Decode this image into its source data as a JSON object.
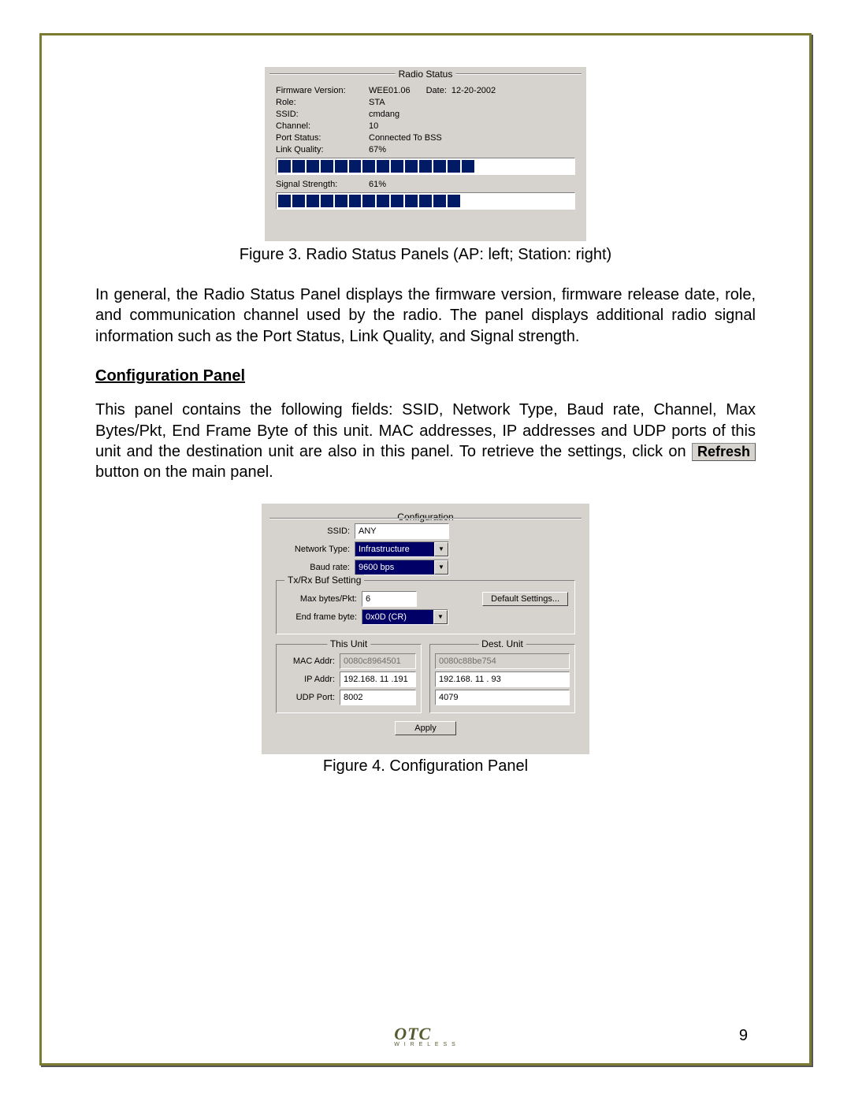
{
  "radio_status": {
    "legend": "Radio Status",
    "firmware_label": "Firmware Version:",
    "firmware_value": "WEE01.06",
    "date_label": "Date:",
    "date_value": "12-20-2002",
    "role_label": "Role:",
    "role_value": "STA",
    "ssid_label": "SSID:",
    "ssid_value": "cmdang",
    "channel_label": "Channel:",
    "channel_value": "10",
    "port_label": "Port Status:",
    "port_value": "Connected To BSS",
    "lq_label": "Link Quality:",
    "lq_value": "67%",
    "ss_label": "Signal Strength:",
    "ss_value": "61%"
  },
  "caption3": "Figure 3. Radio Status Panels (AP: left; Station: right)",
  "para1": "In general, the Radio Status Panel displays the firmware version, firmware release date, role, and communication channel used by the radio. The panel displays additional radio signal information such as the Port Status, Link Quality, and Signal strength.",
  "section_heading": "Configuration Panel",
  "para2_a": "This panel contains the following fields: SSID, Network Type, Baud rate, Channel, Max Bytes/Pkt, End Frame Byte of this unit.  MAC addresses, IP addresses and UDP ports of this unit and the destination unit are also in this panel. To retrieve the settings, click on ",
  "refresh_label": "Refresh",
  "para2_b": " button on the main panel.",
  "config": {
    "legend": "Configuration",
    "ssid_label": "SSID:",
    "ssid_value": "ANY",
    "nettype_label": "Network Type:",
    "nettype_value": "Infrastructure",
    "baud_label": "Baud rate:",
    "baud_value": "9600 bps",
    "txrx_legend": "Tx/Rx Buf Setting",
    "maxbytes_label": "Max bytes/Pkt:",
    "maxbytes_value": "6",
    "default_btn": "Default Settings...",
    "endframe_label": "End frame byte:",
    "endframe_value": "0x0D (CR)",
    "thisunit_legend": "This Unit",
    "destunit_legend": "Dest. Unit",
    "mac_label": "MAC Addr:",
    "ip_label": "IP Addr:",
    "udp_label": "UDP Port:",
    "this_mac": "0080c8964501",
    "this_ip": "192.168. 11 .191",
    "this_udp": "8002",
    "dest_mac": "0080c88be754",
    "dest_ip": "192.168. 11 . 93",
    "dest_udp": "4079",
    "apply_btn": "Apply"
  },
  "caption4": "Figure 4. Configuration Panel",
  "logo_text": "OTC",
  "logo_under": "W I R E L E S S",
  "page_number": "9",
  "chart_data": {
    "type": "bar",
    "description": "Two horizontal segmented progress bars inside the Radio Status panel",
    "bars": [
      {
        "name": "Link Quality",
        "segments_filled": 14,
        "segments_total": 21,
        "percent": 67
      },
      {
        "name": "Signal Strength",
        "segments_filled": 13,
        "segments_total": 21,
        "percent": 61
      }
    ]
  }
}
